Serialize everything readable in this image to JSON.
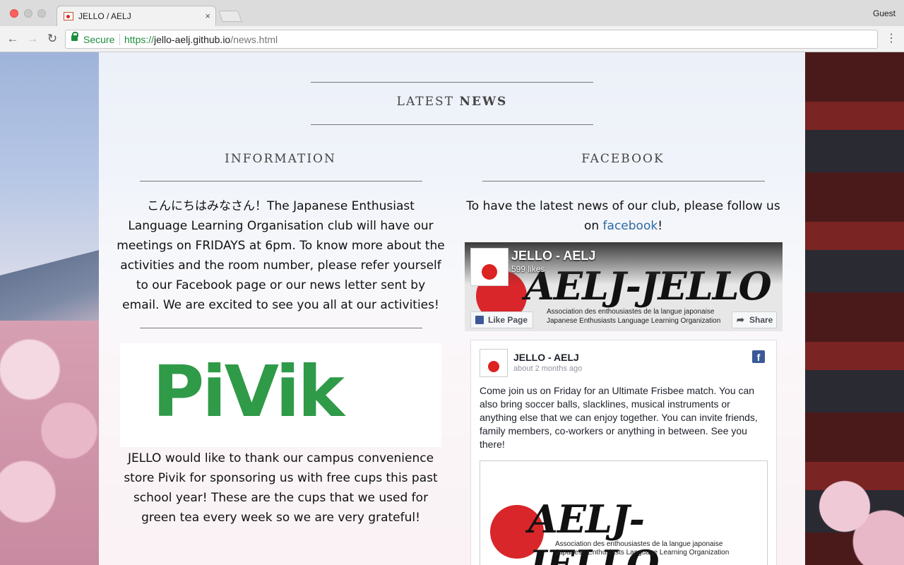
{
  "browser": {
    "tab_title": "JELLO / AELJ",
    "tab_close": "×",
    "user": "Guest",
    "secure_label": "Secure",
    "url_scheme": "https://",
    "url_host": "jello-aelj.github.io",
    "url_path": "/news.html",
    "back_icon": "←",
    "forward_icon": "→",
    "reload_icon": "↻",
    "menu_icon": "⋮"
  },
  "page": {
    "latest_news_a": "LATEST",
    "latest_news_b": "NEWS",
    "information": {
      "heading": "INFORMATION",
      "text": "こんにちはみなさん！The Japanese Enthusiast Language Learning Organisation club will have our meetings on FRIDAYS at 6pm. To know more about the activities and the room number, please refer yourself to our Facebook page or our news letter sent by email. We are excited to see you all at our activities!",
      "pivik_logo": "PiVik",
      "thanks_text": "JELLO would like to thank our campus convenience store Pivik for sponsoring us with free cups this past school year! These are the cups that we used for green tea every week so we are very grateful!"
    },
    "facebook": {
      "heading": "FACEBOOK",
      "intro_before": "To have the latest news of our club, please follow us on",
      "intro_link": "facebook",
      "intro_after": "!",
      "widget": {
        "page_name": "JELLO - AELJ",
        "likes": "599 likes",
        "cover_script": "AELJ-JELLO",
        "cover_sub1": "Association des enthousiastes de la langue japonaise",
        "cover_sub2": "Japanese Enthusiasts Language Learning Organization",
        "like_button": "Like Page",
        "share_button": "Share",
        "share_icon": "➦",
        "post_author": "JELLO - AELJ",
        "post_time": "about 2 months ago",
        "post_icon": "f",
        "post_text": "Come join us on Friday for an Ultimate Frisbee match. You can also bring soccer balls, slacklines, musical instruments or anything else that we can enjoy together. You can invite friends, family members, co-workers or anything in between. See you there!"
      }
    }
  },
  "colors": {
    "link": "#2d6aa3",
    "pivik_green": "#2f9a48",
    "facebook_blue": "#3b5998",
    "secure_green": "#1e8e3e"
  }
}
